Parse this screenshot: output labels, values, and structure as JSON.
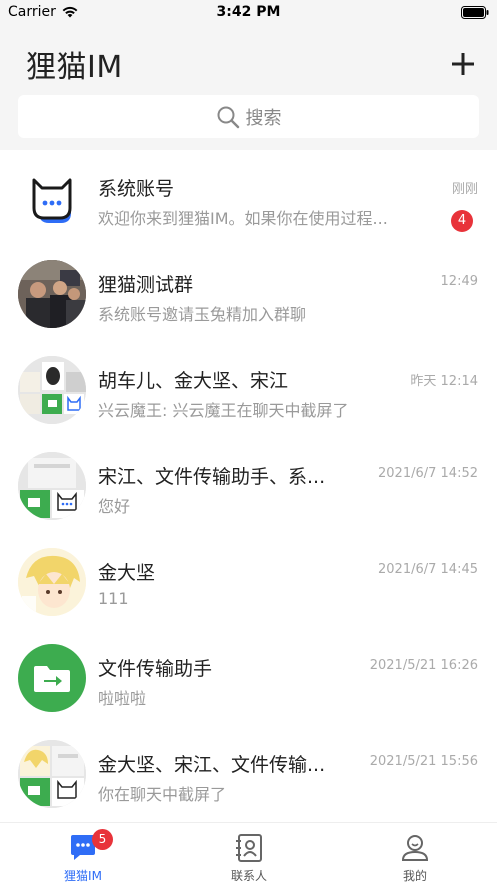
{
  "status_bar": {
    "carrier": "Carrier",
    "time": "3:42 PM"
  },
  "header": {
    "title": "狸猫IM",
    "add_icon": "plus-icon"
  },
  "search": {
    "placeholder": "搜索",
    "icon": "search-icon"
  },
  "chats": [
    {
      "name": "系统账号",
      "preview": "欢迎你来到狸猫IM。如果你在使用过程...",
      "time": "刚刚",
      "unread": "4",
      "avatar": "system-cat-avatar"
    },
    {
      "name": "狸猫测试群",
      "preview": "系统账号邀请玉兔精加入群聊",
      "time": "12:49",
      "avatar": "group-photo-avatar"
    },
    {
      "name": "胡车儿、金大坚、宋江",
      "preview": "兴云魔王: 兴云魔王在聊天中截屏了",
      "time": "昨天 12:14",
      "avatar": "group-grid-avatar"
    },
    {
      "name": "宋江、文件传输助手、系...",
      "preview": "您好",
      "time": "2021/6/7 14:52",
      "avatar": "group-grid-avatar"
    },
    {
      "name": "金大坚",
      "preview": "111",
      "time": "2021/6/7 14:45",
      "avatar": "anime-avatar"
    },
    {
      "name": "文件传输助手",
      "preview": "啦啦啦",
      "time": "2021/5/21 16:26",
      "avatar": "file-transfer-avatar"
    },
    {
      "name": "金大坚、宋江、文件传输...",
      "preview": "你在聊天中截屏了",
      "time": "2021/5/21 15:56",
      "avatar": "group-grid-avatar"
    }
  ],
  "tabs": [
    {
      "label": "狸猫IM",
      "icon": "chat-bubble-icon",
      "badge": "5",
      "active": true
    },
    {
      "label": "联系人",
      "icon": "contacts-icon"
    },
    {
      "label": "我的",
      "icon": "profile-icon"
    }
  ],
  "colors": {
    "accent": "#2f6df6",
    "badge": "#e8333a",
    "file_green": "#3dac4f"
  }
}
